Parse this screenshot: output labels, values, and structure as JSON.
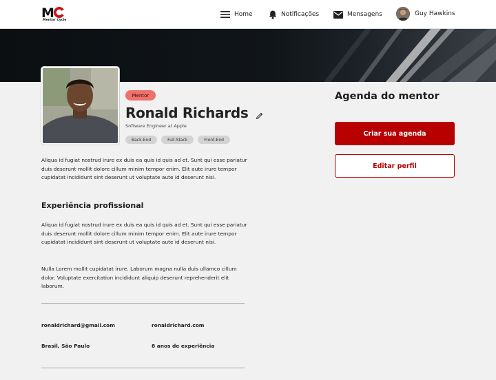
{
  "header": {
    "logo_letters": "MC",
    "logo_text": "Mentor Cycle",
    "nav": {
      "home": "Home",
      "notifications": "Notificações",
      "messages": "Mensagens",
      "user_name": "Guy Hawkins"
    }
  },
  "profile": {
    "badge": "Mentor",
    "name": "Ronald Richards",
    "role": "Software Engineer at Apple",
    "tags": [
      "Back-End",
      "Full-Stack",
      "Front-End"
    ],
    "about": "Aliqua id fugiat nostrud irure ex duis ea quis id quis ad et. Sunt qui esse pariatur duis deserunt mollit dolore cillum minim tempor enim. Elit aute irure tempor cupidatat incididunt sint deserunt ut voluptate aute id deserunt nisi.",
    "experience_title": "Experiência profissional",
    "experience_p1": "Aliqua id fugiat nostrud irure ex duis ea quis id quis ad et. Sunt qui esse pariatur duis deserunt mollit dolore cillum minim tempor enim. Elit aute irure tempor cupidatat incididunt sint deserunt ut voluptate aute id deserunt nisi.",
    "experience_p2": "Nulla Lorem mollit cupidatat irure. Laborum magna nulla duis ullamco cillum dolor. Voluptate exercitation incididunt aliquip deserunt reprehenderit elit laborum.",
    "email_primary": "ronaldrichard@gmail.com",
    "email_secondary": "ronaldrichard.com",
    "location": "Brasil, São Paulo",
    "experience_years": "8 anos de experiência"
  },
  "agenda": {
    "title": "Agenda do mentor",
    "create_button": "Criar sua agenda",
    "edit_button": "Editar perfil"
  },
  "colors": {
    "accent": "#b80000",
    "badge": "#f0706c",
    "tag": "#d3d3d3",
    "background": "#f1f1f1"
  },
  "icons": [
    "logo-icon",
    "menu-icon",
    "bell-icon",
    "mail-icon",
    "avatar",
    "pencil-icon"
  ]
}
